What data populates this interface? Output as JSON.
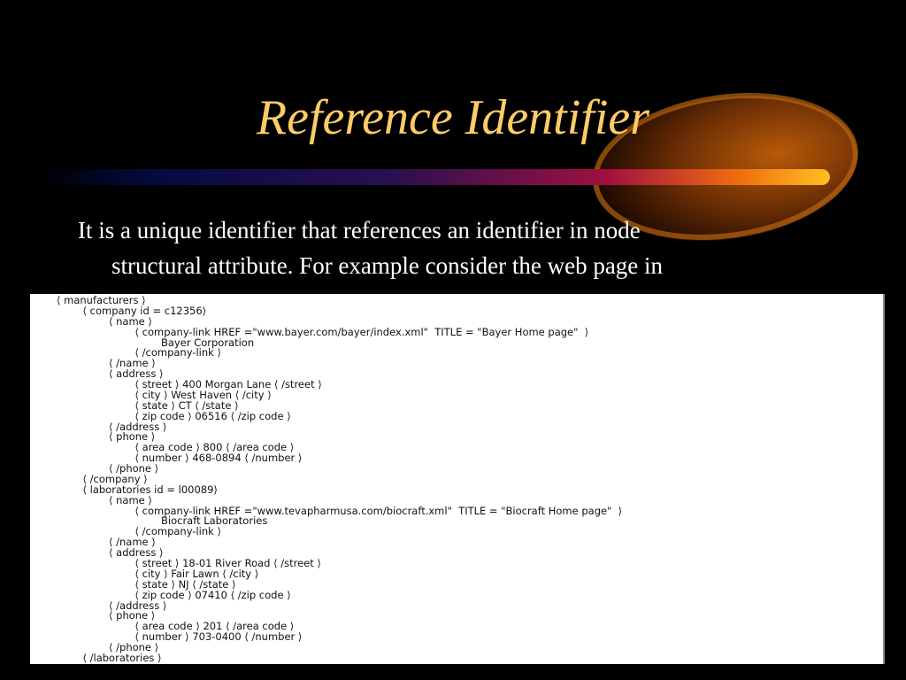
{
  "slide": {
    "title": "Reference Identifier",
    "body_lines": [
      "It is a unique identifier that references an identifier in node",
      "structural attribute. For example consider the web page in"
    ]
  },
  "code_lines": [
    {
      "indent": 1,
      "text": "⟨ manufacturers ⟩"
    },
    {
      "indent": 2,
      "text": "⟨ company id = c12356⟩"
    },
    {
      "indent": 3,
      "text": "⟨ name ⟩"
    },
    {
      "indent": 4,
      "text": "⟨ company-link HREF =\"www.bayer.com/bayer/index.xml\"  TITLE = \"Bayer Home page\"  ⟩"
    },
    {
      "indent": 5,
      "text": "Bayer Corporation"
    },
    {
      "indent": 4,
      "text": "⟨ /company-link ⟩"
    },
    {
      "indent": 3,
      "text": "⟨ /name ⟩"
    },
    {
      "indent": 3,
      "text": "⟨ address ⟩"
    },
    {
      "indent": 4,
      "text": "⟨ street ⟩ 400 Morgan Lane ⟨ /street ⟩"
    },
    {
      "indent": 4,
      "text": "⟨ city ⟩ West Haven ⟨ /city ⟩"
    },
    {
      "indent": 4,
      "text": "⟨ state ⟩ CT ⟨ /state ⟩"
    },
    {
      "indent": 4,
      "text": "⟨ zip code ⟩ 06516 ⟨ /zip code ⟩"
    },
    {
      "indent": 3,
      "text": "⟨ /address ⟩"
    },
    {
      "indent": 3,
      "text": "⟨ phone ⟩"
    },
    {
      "indent": 4,
      "text": "⟨ area code ⟩ 800 ⟨ /area code ⟩"
    },
    {
      "indent": 4,
      "text": "⟨ number ⟩ 468-0894 ⟨ /number ⟩"
    },
    {
      "indent": 3,
      "text": "⟨ /phone ⟩"
    },
    {
      "indent": 2,
      "text": "⟨ /company ⟩"
    },
    {
      "indent": 2,
      "text": "⟨ laboratories id = l00089⟩"
    },
    {
      "indent": 3,
      "text": "⟨ name ⟩"
    },
    {
      "indent": 4,
      "text": "⟨ company-link HREF =\"www.tevapharmusa.com/biocraft.xml\"  TITLE = \"Biocraft Home page\"  ⟩"
    },
    {
      "indent": 5,
      "text": "Biocraft Laboratories"
    },
    {
      "indent": 4,
      "text": "⟨ /company-link ⟩"
    },
    {
      "indent": 3,
      "text": "⟨ /name ⟩"
    },
    {
      "indent": 3,
      "text": "⟨ address ⟩"
    },
    {
      "indent": 4,
      "text": "⟨ street ⟩ 18-01 River Road ⟨ /street ⟩"
    },
    {
      "indent": 4,
      "text": "⟨ city ⟩ Fair Lawn ⟨ /city ⟩"
    },
    {
      "indent": 4,
      "text": "⟨ state ⟩ NJ ⟨ /state ⟩"
    },
    {
      "indent": 4,
      "text": "⟨ zip code ⟩ 07410 ⟨ /zip code ⟩"
    },
    {
      "indent": 3,
      "text": "⟨ /address ⟩"
    },
    {
      "indent": 3,
      "text": "⟨ phone ⟩"
    },
    {
      "indent": 4,
      "text": "⟨ area code ⟩ 201 ⟨ /area code ⟩"
    },
    {
      "indent": 4,
      "text": "⟨ number ⟩ 703-0400 ⟨ /number ⟩"
    },
    {
      "indent": 3,
      "text": "⟨ /phone ⟩"
    },
    {
      "indent": 2,
      "text": "⟨ /laboratories ⟩"
    }
  ],
  "colors": {
    "background": "#000000",
    "title": "#ffcc66",
    "body_text": "#ffffff",
    "panel": "#ffffff",
    "swoosh_start": "#000033",
    "swoosh_mid": "#990033",
    "swoosh_end": "#ffaa00"
  }
}
